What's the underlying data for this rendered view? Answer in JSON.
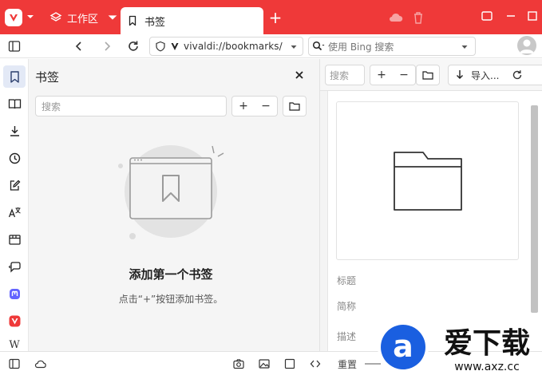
{
  "titlebar": {
    "workspace_label": "工作区",
    "active_tab_title": "书签",
    "new_tab_symbol": "+",
    "bg_color": "#ef3939"
  },
  "addressbar": {
    "url": "vivaldi://bookmarks/",
    "search_placeholder": "使用 Bing 搜索"
  },
  "panel": {
    "title": "书签",
    "search_placeholder": "搜索",
    "add_symbol": "+",
    "remove_symbol": "−",
    "empty_title": "添加第一个书签",
    "empty_subtitle": "点击“+”按钮添加书签。"
  },
  "rail": {
    "items": [
      "bookmark-icon",
      "reading-list-icon",
      "download-icon",
      "history-icon",
      "notes-icon",
      "translate-icon",
      "window-icon",
      "feeds-icon",
      "mastodon-icon",
      "vivaldi-icon"
    ],
    "wiki_label": "W",
    "active_color": "#e3e9f6"
  },
  "manager": {
    "search_placeholder": "搜索",
    "add_symbol": "+",
    "remove_symbol": "−",
    "import_label": "导入...",
    "fields": {
      "title_label": "标题",
      "nickname_label": "简称",
      "description_label": "描述"
    }
  },
  "statusbar": {
    "reset_label": "重置"
  },
  "watermark": {
    "brand_text": "爱下载",
    "url_text": "www.axz.cc"
  }
}
